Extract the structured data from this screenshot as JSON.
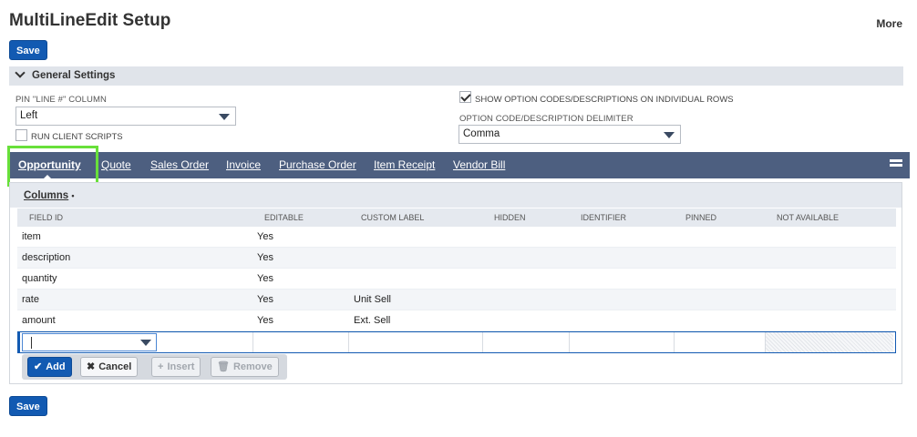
{
  "page": {
    "title": "MultiLineEdit Setup",
    "more_label": "More"
  },
  "buttons": {
    "save_top": "Save",
    "save_bottom": "Save"
  },
  "section": {
    "title": "General Settings"
  },
  "settings": {
    "pin_label": "PIN \"LINE #\" COLUMN",
    "pin_value": "Left",
    "run_client_scripts_label": "RUN CLIENT SCRIPTS",
    "run_client_scripts_checked": false,
    "show_codes_label": "SHOW OPTION CODES/DESCRIPTIONS ON INDIVIDUAL ROWS",
    "show_codes_checked": true,
    "delimiter_label": "OPTION CODE/DESCRIPTION DELIMITER",
    "delimiter_value": "Comma"
  },
  "tabs": [
    {
      "label": "Opportunity",
      "active": true
    },
    {
      "label": "Quote",
      "active": false
    },
    {
      "label": "Sales Order",
      "active": false
    },
    {
      "label": "Invoice",
      "active": false
    },
    {
      "label": "Purchase Order",
      "active": false
    },
    {
      "label": "Item Receipt",
      "active": false
    },
    {
      "label": "Vendor Bill",
      "active": false
    }
  ],
  "subtab": {
    "title": "Columns",
    "marker": "•"
  },
  "grid": {
    "headers": [
      "FIELD ID",
      "EDITABLE",
      "CUSTOM LABEL",
      "HIDDEN",
      "IDENTIFIER",
      "PINNED",
      "NOT AVAILABLE"
    ],
    "rows": [
      {
        "field_id": "item",
        "editable": "Yes",
        "custom_label": ""
      },
      {
        "field_id": "description",
        "editable": "Yes",
        "custom_label": ""
      },
      {
        "field_id": "quantity",
        "editable": "Yes",
        "custom_label": ""
      },
      {
        "field_id": "rate",
        "editable": "Yes",
        "custom_label": "Unit Sell"
      },
      {
        "field_id": "amount",
        "editable": "Yes",
        "custom_label": "Ext. Sell"
      }
    ]
  },
  "actions": {
    "add": "Add",
    "cancel": "Cancel",
    "insert": "Insert",
    "remove": "Remove"
  },
  "colors": {
    "primary": "#125ab2",
    "tabbar": "#4d5f80",
    "highlight": "#68e03a"
  }
}
